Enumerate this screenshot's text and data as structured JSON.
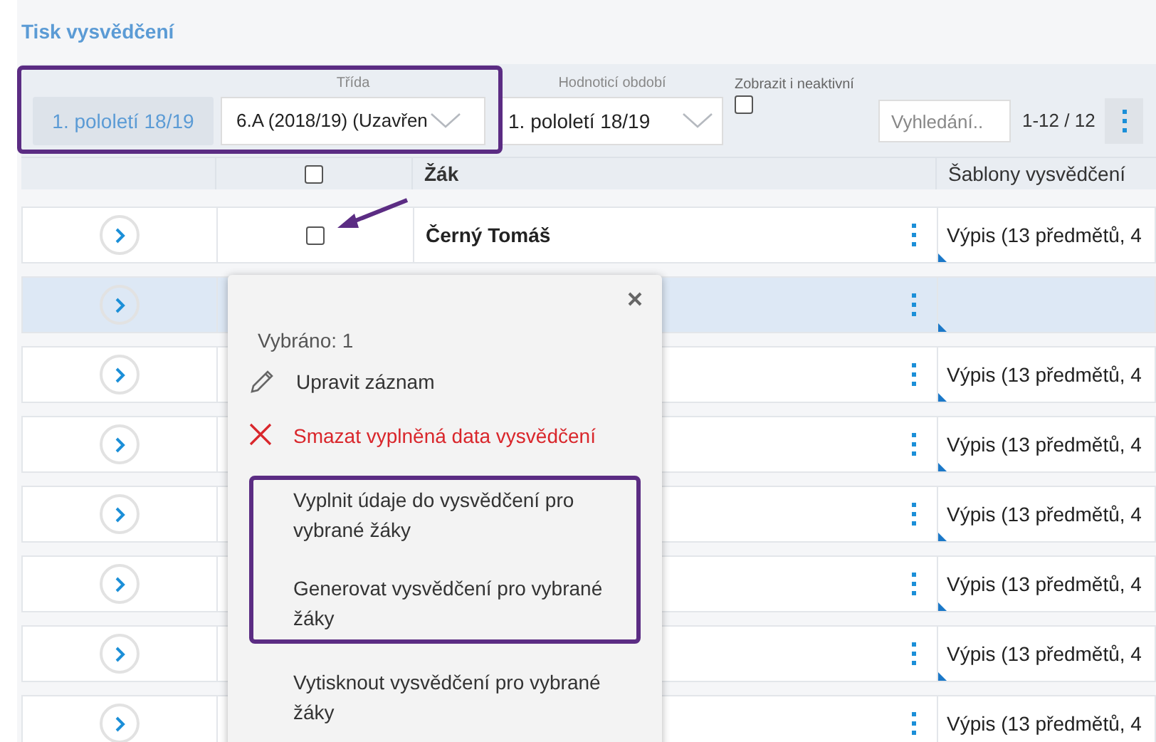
{
  "title": "Tisk vysvědčení",
  "toolbar": {
    "highlighted": true,
    "period_button": "1. pololetí 18/19",
    "class_select": {
      "label": "Třída",
      "value": "6.A (2018/19) (Uzavřen"
    },
    "period_select": {
      "label": "Hodnoticí období",
      "value": "1. pololetí 18/19"
    },
    "inactive": {
      "label": "Zobrazit i neaktivní",
      "checked": false
    },
    "search": {
      "placeholder": "Vyhledání.."
    },
    "count": "1-12 / 12"
  },
  "table": {
    "columns": [
      "Žák",
      "Šablony vysvědčení"
    ],
    "select_all_checked": false,
    "rows": [
      {
        "student": "Černý Tomáš",
        "template": "Výpis (13 předmětů, 4",
        "checked": false,
        "selected": false,
        "pointed": true
      },
      {
        "selected": true
      },
      {
        "template": "Výpis (13 předmětů, 4",
        "selected": false
      },
      {
        "template": "Výpis (13 předmětů, 4",
        "selected": false
      },
      {
        "template": "Výpis (13 předmětů, 4",
        "selected": false
      },
      {
        "template": "Výpis (13 předmětů, 4",
        "selected": false
      },
      {
        "template": "Výpis (13 předmětů, 4",
        "selected": false
      },
      {
        "template": "Výpis (13 předmětů, 4",
        "selected": false
      }
    ]
  },
  "popup": {
    "summary": "Vybráno: 1",
    "actions": [
      {
        "label": "Upravit záznam",
        "kind": "edit",
        "highlighted": false
      },
      {
        "label": "Smazat vyplněná data vysvědčení",
        "kind": "delete",
        "highlighted": false
      },
      {
        "label": "Vyplnit údaje do vysvědčení pro vybrané žáky",
        "kind": "plain",
        "highlighted": true
      },
      {
        "label": "Generovat vysvědčení pro vybrané žáky",
        "kind": "plain",
        "highlighted": true
      },
      {
        "label": "Vytisknout vysvědčení pro vybrané žáky",
        "kind": "plain",
        "highlighted": false
      }
    ]
  }
}
